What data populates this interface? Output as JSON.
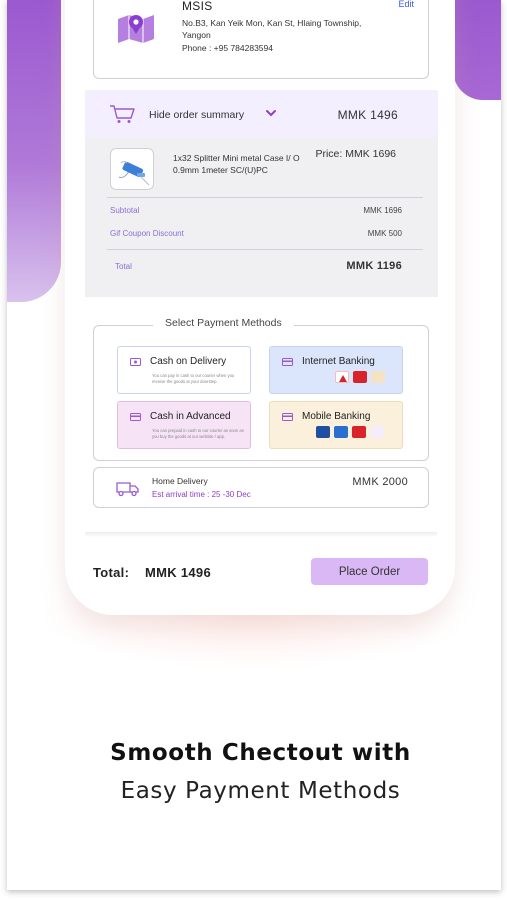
{
  "address": {
    "name": "MSIS",
    "line1": "No.B3, Kan Yeik Mon, Kan St, Hlaing Township,",
    "line2": "Yangon",
    "phone": "Phone : +95 784283594",
    "edit_label": "Edit"
  },
  "order_summary": {
    "toggle_label": "Hide order summary",
    "header_total": "MMK 1496",
    "product_name": "1x32 Splitter Mini metal Case I/ O 0.9mm 1meter SC/(U)PC",
    "product_price": "Price: MMK 1696",
    "subtotal_label": "Subtotal",
    "subtotal_value": "MMK 1696",
    "discount_label": "Gif Coupon Discount",
    "discount_value": "MMK 500",
    "total_label": "Total",
    "total_value": "MMK 1196"
  },
  "payment": {
    "title": "Select Payment Methods",
    "options": [
      {
        "label": "Cash on Delivery",
        "note": "You can pay in cash to our courier when you receive the goods at your doorstep."
      },
      {
        "label": "Internet Banking"
      },
      {
        "label": "Cash in Advanced",
        "note": "You can prepaid in cash to our courier as soon as you buy the goods at our website / app."
      },
      {
        "label": "Mobile Banking"
      }
    ]
  },
  "delivery": {
    "title": "Home Delivery",
    "eta": "Est arrival time : 25 -30 Dec",
    "price": "MMK 2000"
  },
  "footer": {
    "total_label": "Total:",
    "total_value": "MMK 1496",
    "place_order_label": "Place Order"
  },
  "promo": {
    "headline": "Smooth Chectout with",
    "subline": "Easy Payment Methods"
  },
  "colors": {
    "accent_purple": "#9b59d0",
    "button_bg": "#d9b8f5",
    "link_blue": "#3b5bdb"
  }
}
